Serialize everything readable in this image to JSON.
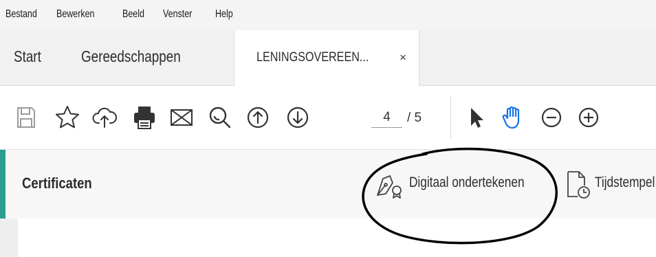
{
  "menu": [
    "Bestand",
    "Bewerken",
    "Beeld",
    "Venster",
    "Help"
  ],
  "tabs": {
    "start": "Start",
    "tools": "Gereedschappen",
    "document": "LENINGSOVEREEN...",
    "close_symbol": "×"
  },
  "toolbar": {
    "icons": [
      "save-icon",
      "star-icon",
      "cloud-upload-icon",
      "print-icon",
      "mail-icon",
      "zoom-search-icon",
      "arrow-up-icon",
      "arrow-down-icon",
      "pointer-icon",
      "hand-icon",
      "zoom-out-icon",
      "zoom-in-icon"
    ],
    "page_current": "4",
    "page_total": "/ 5"
  },
  "certificates": {
    "heading": "Certificaten",
    "sign_label": "Digitaal ondertekenen",
    "timestamp_label": "Tijdstempel"
  },
  "colors": {
    "accent": "#2a9d8f",
    "hand_blue": "#1473e6"
  }
}
